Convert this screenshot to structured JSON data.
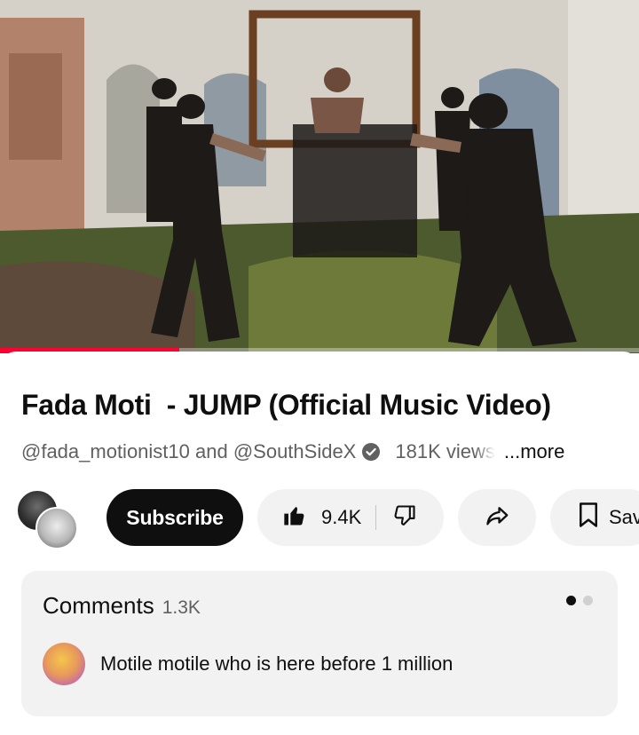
{
  "video": {
    "progress": 0.28,
    "accent_color": "#ff0033"
  },
  "title": "Fada Moti  - JUMP (Official Music Video)",
  "meta": {
    "channels": "@fada_motionist10 and @SouthSideX",
    "views": "181K views",
    "more": "...more",
    "verified_icon": "verified-check-icon"
  },
  "actions": {
    "subscribe": "Subscribe",
    "like_count": "9.4K",
    "save": "Save",
    "icons": [
      "thumbs-up-icon",
      "thumbs-down-icon",
      "share-icon",
      "bookmark-icon"
    ]
  },
  "comments": {
    "title": "Comments",
    "count": "1.3K",
    "top_comment": "Motile motile who is here before 1 million"
  }
}
